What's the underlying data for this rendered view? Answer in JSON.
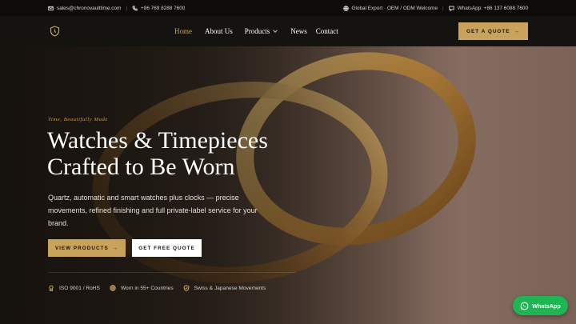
{
  "topbar": {
    "email": "sales@chronovaulttime.com",
    "phone": "+86 769 8288 7600",
    "tagline": "Global Export · OEM / ODM Welcome",
    "whatsapp": "WhatsApp: +86 137 6088 7600"
  },
  "nav": {
    "items": [
      {
        "label": "Home",
        "active": true
      },
      {
        "label": "About Us"
      },
      {
        "label": "Products"
      },
      {
        "label": "News"
      },
      {
        "label": "Contact"
      }
    ],
    "cta_label": "GET A QUOTE"
  },
  "hero": {
    "eyebrow": "Time, Beautifully Made",
    "headline_line1": "Watches & Timepieces",
    "headline_line2": "Crafted to Be Worn",
    "subtext": "Quartz, automatic and smart watches plus clocks — precise movements, refined finishing and full private-label service for your brand.",
    "primary_label": "VIEW PRODUCTS",
    "secondary_label": "GET FREE QUOTE",
    "badges": [
      {
        "label": "ISO 9001 / RoHS",
        "icon": "award-icon"
      },
      {
        "label": "Worn in 55+ Countries",
        "icon": "globe-icon"
      },
      {
        "label": "Swiss & Japanese Movements",
        "icon": "shield-icon"
      }
    ]
  },
  "floating": {
    "whatsapp_label": "WhatsApp"
  },
  "colors": {
    "accent": "#c9a35c",
    "dark": "#15130f",
    "whatsapp": "#1fb454"
  }
}
